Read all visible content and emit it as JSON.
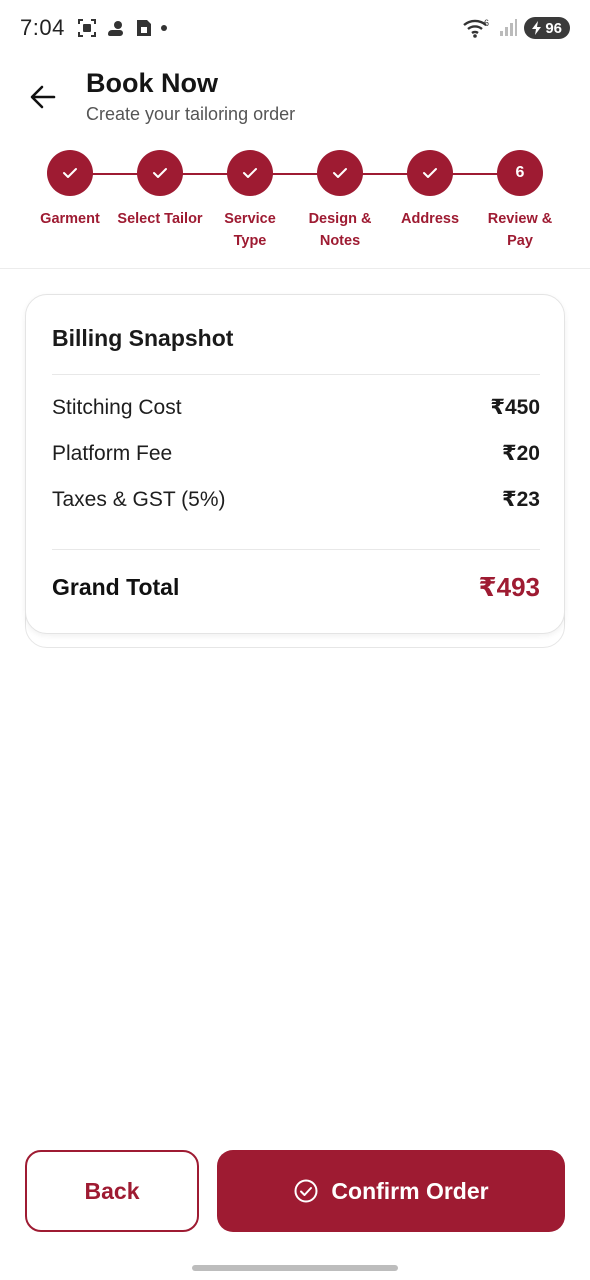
{
  "status_bar": {
    "time": "7:04",
    "icons": [
      "screenshot-icon",
      "weather-icon",
      "sim-icon"
    ],
    "wifi_badge": "6",
    "battery": "96"
  },
  "header": {
    "title": "Book Now",
    "subtitle": "Create your tailoring order"
  },
  "stepper": {
    "accent": "#9e1b32",
    "steps": [
      {
        "label_line1": "Garment",
        "label_line2": "",
        "state": "done"
      },
      {
        "label_line1": "Select Tailor",
        "label_line2": "",
        "state": "done"
      },
      {
        "label_line1": "Service",
        "label_line2": "Type",
        "state": "done"
      },
      {
        "label_line1": "Design &",
        "label_line2": "Notes",
        "state": "done"
      },
      {
        "label_line1": "Address",
        "label_line2": "",
        "state": "done"
      },
      {
        "label_line1": "Review &",
        "label_line2": "Pay",
        "state": "current",
        "number": "6"
      }
    ]
  },
  "billing": {
    "title": "Billing Snapshot",
    "rows": [
      {
        "label": "Stitching Cost",
        "value": "₹450"
      },
      {
        "label": "Platform Fee",
        "value": "₹20"
      },
      {
        "label": "Taxes & GST (5%)",
        "value": "₹23"
      }
    ],
    "total_label": "Grand Total",
    "total_value": "₹493"
  },
  "actions": {
    "back_label": "Back",
    "confirm_label": "Confirm Order"
  }
}
